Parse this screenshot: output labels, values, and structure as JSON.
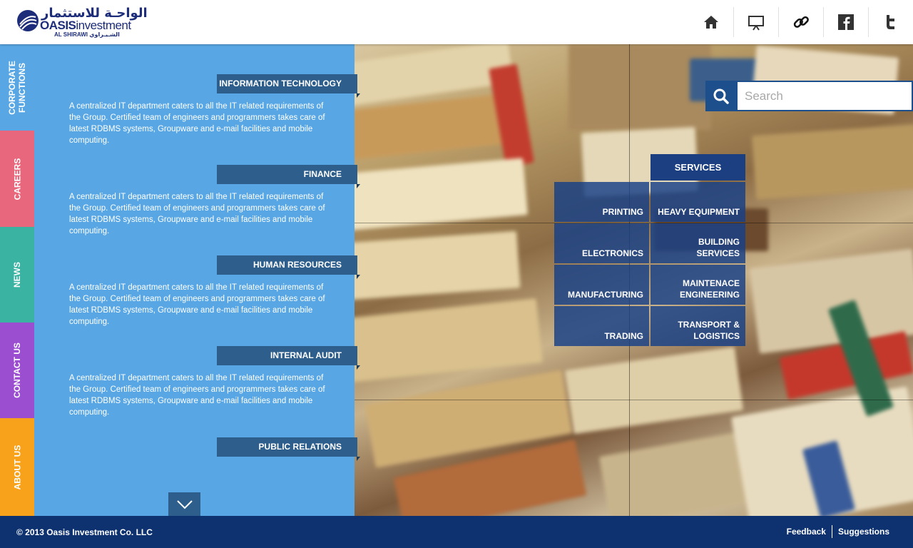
{
  "header": {
    "logo": {
      "arabic": "الواحـة للاستثمار",
      "name_bold": "OASIS",
      "name_rest": "investment",
      "sub_en": "AL SHIRAWI",
      "sub_ar": "الشـيـراوي"
    },
    "icons": [
      "home-icon",
      "presentation-icon",
      "link-icon",
      "facebook-icon",
      "twitter-icon"
    ]
  },
  "side_tabs": [
    {
      "label": "CORPORATE FUNCTIONS",
      "color": "#58a7e4"
    },
    {
      "label": "CAREERS",
      "color": "#e8677d"
    },
    {
      "label": "NEWS",
      "color": "#3bb3a3"
    },
    {
      "label": "CONTACT US",
      "color": "#9b4fd0"
    },
    {
      "label": "ABOUT US",
      "color": "#f8a21b"
    }
  ],
  "sections": [
    {
      "title": "INFORMATION TECHNOLOGY",
      "text": "A centralized IT department caters to all the IT related requirements of the Group. Certified team of engineers and programmers takes care of latest RDBMS systems, Groupware and e-mail facilities and mobile computing."
    },
    {
      "title": "FINANCE",
      "text": "A centralized IT department caters to all the IT related requirements of the Group. Certified team of engineers and programmers takes care of latest RDBMS systems, Groupware and e-mail facilities and mobile computing."
    },
    {
      "title": "HUMAN RESOURCES",
      "text": "A centralized IT department caters to all the IT related requirements of the Group. Certified team of engineers and programmers takes care of latest RDBMS systems, Groupware and e-mail facilities and mobile computing."
    },
    {
      "title": "INTERNAL AUDIT",
      "text": "A centralized IT department caters to all the IT related requirements of the Group. Certified team of engineers and programmers takes care of latest RDBMS systems, Groupware and e-mail facilities and mobile computing."
    },
    {
      "title": "PUBLIC RELATIONS"
    }
  ],
  "search": {
    "placeholder": "Search"
  },
  "services": {
    "title": "SERVICES",
    "items": [
      "PRINTING",
      "HEAVY EQUIPMENT",
      "ELECTRONICS",
      "BUILDING SERVICES",
      "MANUFACTURING",
      "MAINTENACE ENGINEERING",
      "TRADING",
      "TRANSPORT & LOGISTICS"
    ]
  },
  "footer": {
    "copyright": "© 2013 Oasis Investment Co. LLC",
    "links": [
      "Feedback",
      "Suggestions"
    ]
  },
  "colors": {
    "panel": "#58a7e4",
    "section_title_bg": "#2e5f8c",
    "footer": "#0e3270",
    "services": "#1b3f80"
  }
}
